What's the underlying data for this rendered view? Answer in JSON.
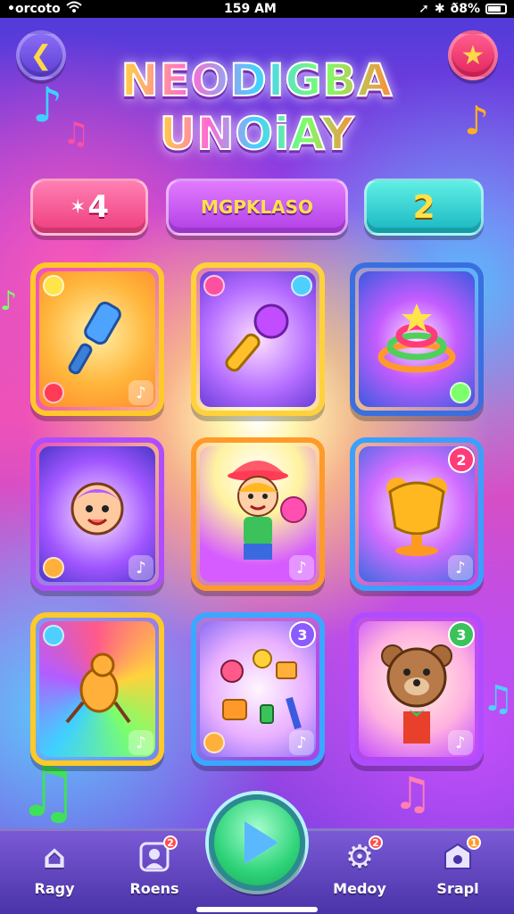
{
  "status_bar": {
    "carrier": "•orcoto",
    "time": "159 AM",
    "battery": "ð8%",
    "wifi_icon": "wifi-icon",
    "location_icon": "location-icon",
    "bluetooth_icon": "bluetooth-icon"
  },
  "header": {
    "back_icon": "back-arrow-icon",
    "star_icon": "star-icon",
    "logo_line1": "NEODIGBA",
    "logo_line2": "UNOiAY"
  },
  "stats": {
    "left_value": "4",
    "middle_label": "MGPKLASO",
    "right_value": "2"
  },
  "cards": [
    {
      "id": "card-1",
      "icon": "tool-icon",
      "badge": ""
    },
    {
      "id": "card-2",
      "icon": "microphone-icon",
      "badge": ""
    },
    {
      "id": "card-3",
      "icon": "rings-icon",
      "badge": ""
    },
    {
      "id": "card-4",
      "icon": "kid-face-icon",
      "badge": ""
    },
    {
      "id": "card-5",
      "icon": "kid-with-ball-icon",
      "badge": ""
    },
    {
      "id": "card-6",
      "icon": "bear-trophy-icon",
      "badge": "2"
    },
    {
      "id": "card-7",
      "icon": "rainbow-creature-icon",
      "badge": ""
    },
    {
      "id": "card-8",
      "icon": "instruments-icon",
      "badge": "3"
    },
    {
      "id": "card-9",
      "icon": "teddy-bear-icon",
      "badge": "3"
    }
  ],
  "nav": [
    {
      "label": "Ragy",
      "icon": "home-icon",
      "badge": ""
    },
    {
      "label": "Roens",
      "icon": "profile-icon",
      "badge": "2"
    },
    {
      "label": "Medoy",
      "icon": "settings-gear-icon",
      "badge": "2"
    },
    {
      "label": "Srapl",
      "icon": "shop-icon",
      "badge": "1"
    }
  ],
  "play": {
    "icon": "play-icon"
  }
}
